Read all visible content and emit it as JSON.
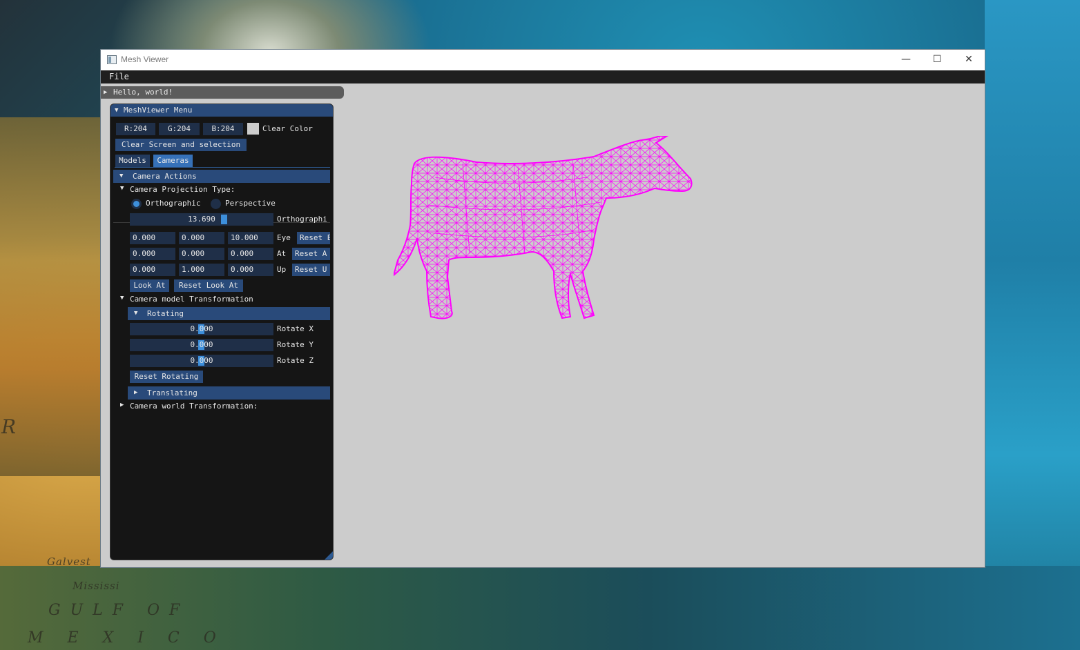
{
  "window": {
    "title": "Mesh Viewer",
    "controls": [
      "—",
      "☐",
      "✕"
    ]
  },
  "menubar": {
    "file": "File"
  },
  "hello_window": {
    "title": "Hello, world!"
  },
  "panel": {
    "title": "MeshViewer Menu",
    "clear_color": {
      "r": "R:204",
      "g": "G:204",
      "b": "B:204",
      "swatch": "#cccccc",
      "label": "Clear Color"
    },
    "clear_screen_button": "Clear Screen and selection",
    "tabs": [
      {
        "label": "Models",
        "active": false
      },
      {
        "label": "Cameras",
        "active": true
      }
    ],
    "camera_actions": {
      "header": "Camera Actions",
      "projection": {
        "header": "Camera Projection Type:",
        "orthographic": "Orthographic",
        "perspective": "Perspective",
        "selected": "Orthographic",
        "slider_value": "13.690",
        "slider_label": "Orthographi"
      },
      "eye": {
        "x": "0.000",
        "y": "0.000",
        "z": "10.000",
        "label": "Eye",
        "reset": "Reset E"
      },
      "at": {
        "x": "0.000",
        "y": "0.000",
        "z": "0.000",
        "label": "At",
        "reset": "Reset A"
      },
      "up": {
        "x": "0.000",
        "y": "1.000",
        "z": "0.000",
        "label": "Up",
        "reset": "Reset U"
      },
      "look_at": "Look At",
      "reset_look_at": "Reset Look At"
    },
    "model_transform": {
      "header": "Camera model Transformation",
      "rotating": {
        "header": "Rotating",
        "x": {
          "value": "0.000",
          "label": "Rotate X"
        },
        "y": {
          "value": "0.000",
          "label": "Rotate Y"
        },
        "z": {
          "value": "0.000",
          "label": "Rotate Z"
        },
        "reset": "Reset Rotating"
      },
      "translating": {
        "header": "Translating"
      }
    },
    "world_transform": {
      "header": "Camera world Transformation:"
    }
  },
  "scene": {
    "background": "#cccccc",
    "mesh_color": "#ff00ff"
  },
  "desktop": {
    "map_words": [
      "GULF OF",
      "M E X I C O",
      "Mississi",
      "Galvest",
      "R"
    ]
  }
}
